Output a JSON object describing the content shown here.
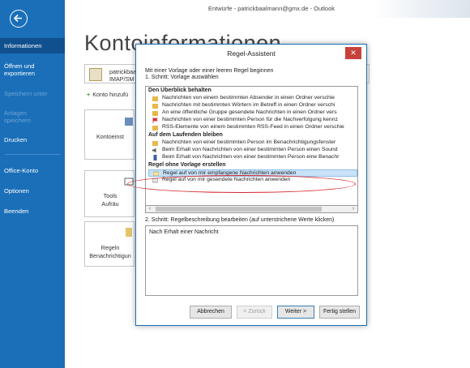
{
  "window": {
    "title": "Entwürfe - patrickbaalmann@gmx.de - Outlook"
  },
  "nav": {
    "items": [
      {
        "label": "Informationen",
        "state": "active"
      },
      {
        "label": "Öffnen und\nexportieren",
        "state": "normal"
      },
      {
        "label": "Speichern unter",
        "state": "disabled"
      },
      {
        "label": "Anlagen\nspeichern",
        "state": "disabled"
      },
      {
        "label": "Drucken",
        "state": "normal"
      },
      {
        "label": "Office-Konto",
        "state": "normal"
      },
      {
        "label": "Optionen",
        "state": "normal"
      },
      {
        "label": "Beenden",
        "state": "normal"
      }
    ],
    "back_icon": "arrow-left-circle-icon"
  },
  "background": {
    "page_title": "Kontoinformationen",
    "account_line1": "patrickbaa",
    "account_line2": "IMAP/SM",
    "add_account_label": "Konto hinzufü",
    "tile1_label": "Kontoeinst",
    "tile2_label_1": "Tools",
    "tile2_label_2": "Aufräu",
    "tile3_label_1": "Regeln",
    "tile3_label_2": "Benachrichtigun"
  },
  "dialog": {
    "title": "Regel-Assistent",
    "close_glyph": "✕",
    "intro": "Mit einer Vorlage oder einer leeren Regel beginnen",
    "step1": "1. Schritt: Vorlage auswählen",
    "groups": [
      {
        "heading": "Den Überblick behalten"
      },
      {
        "heading": "Auf dem Laufenden bleiben"
      },
      {
        "heading": "Regel ohne Vorlage erstellen"
      }
    ],
    "rows": [
      "Nachrichten von einem bestimmten Absender in einen Ordner verschie",
      "Nachrichten mit bestimmten Wörtern im Betreff in einen Ordner verschi",
      "An eine öffentliche Gruppe gesendete Nachrichten in einen Ordner vers",
      "Nachrichten von einer bestimmten Person für die Nachverfolgung kennz",
      "RSS-Elemente von einem bestimmten RSS-Feed in einen Ordner verschie",
      "Nachrichten von einer bestimmten Person im Benachrichtigungsfenster",
      "Beim Erhalt von Nachrichten von einer bestimmten Person einen Sound",
      "Beim Erhalt von Nachrichten von einer bestimmten Person eine Benachr",
      "Regel auf von mir empfangene Nachrichten anwenden",
      "Regel auf von mir gesendete Nachrichten anwenden"
    ],
    "step2": "2. Schritt: Regelbeschreibung bearbeiten (auf unterstrichene Werte klicken)",
    "description": "Nach Erhalt einer Nachricht",
    "buttons": {
      "cancel": "Abbrechen",
      "back": "< Zurück",
      "next": "Weiter >",
      "finish": "Fertig stellen"
    },
    "colors": {
      "selection": "#c8e2f8",
      "highlight_oval": "#d8252a",
      "close_button": "#c7413b"
    }
  }
}
